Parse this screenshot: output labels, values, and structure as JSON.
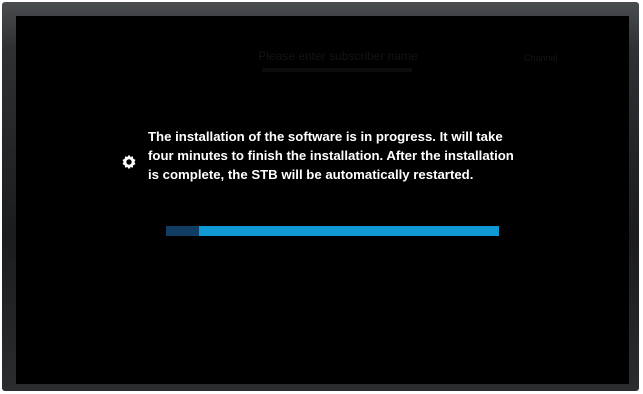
{
  "background_title": "Please enter subscriber name",
  "background_right_text": "Channel",
  "message": {
    "icon": "gear-icon",
    "text": "The installation of the software is in progress. It will take\nfour minutes to finish the installation. After the installation\nis complete, the STB will be automatically restarted."
  },
  "progress": {
    "fraction": 0.1,
    "color_fill": "#123d63",
    "color_track": "#0f9ad6"
  }
}
